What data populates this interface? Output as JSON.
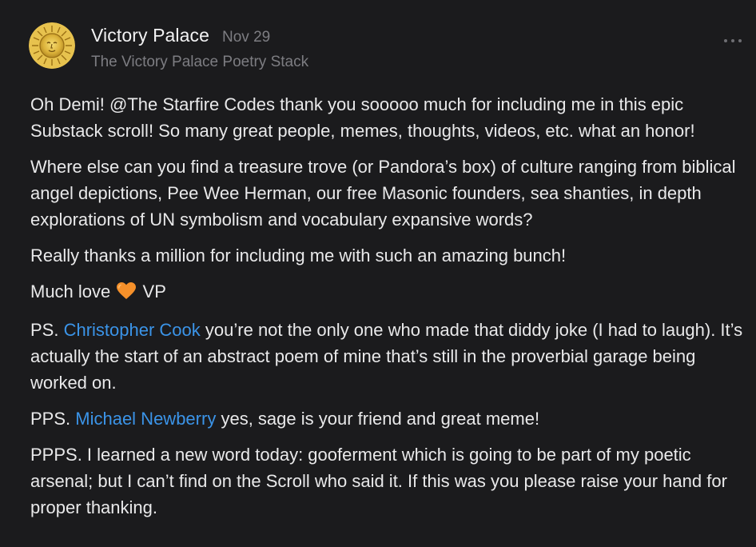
{
  "post": {
    "author": "Victory Palace",
    "date": "Nov 29",
    "publication": "The Victory Palace Poetry Stack",
    "avatar_icon": "sun-face-icon",
    "menu_icon": "more-horizontal-icon",
    "accent_color": "#3b94e8",
    "paragraphs": {
      "p1": "Oh Demi! @The Starfire Codes thank you sooooo much for including me in this epic Substack scroll! So many great people, memes, thoughts, videos, etc. what an honor!",
      "p2": "Where else can you find a treasure trove (or Pandora’s box) of culture ranging from biblical angel depictions, Pee Wee Herman, our free Masonic founders, sea shanties, in depth explorations of UN symbolism and vocabulary expansive words?",
      "p3": "Really thanks a million for including me with such an amazing bunch!",
      "p4_before": "Much love",
      "p4_emoji": "orange-heart-icon",
      "p4_after": "VP",
      "p5_prefix": "PS.",
      "p5_mention": "Christopher Cook",
      "p5_text": "you’re not the only one who made that diddy joke (I had to laugh). It’s actually the start of an abstract poem of mine that’s still in the proverbial garage being worked on.",
      "p6_prefix": "PPS.",
      "p6_mention": "Michael Newberry",
      "p6_text": "yes, sage is your friend and great meme!",
      "p7": "PPPS. I learned a new word today: gooferment which is going to be part of my poetic arsenal; but I can’t find on the Scroll who said it. If this was you please raise your hand for proper thanking."
    }
  }
}
